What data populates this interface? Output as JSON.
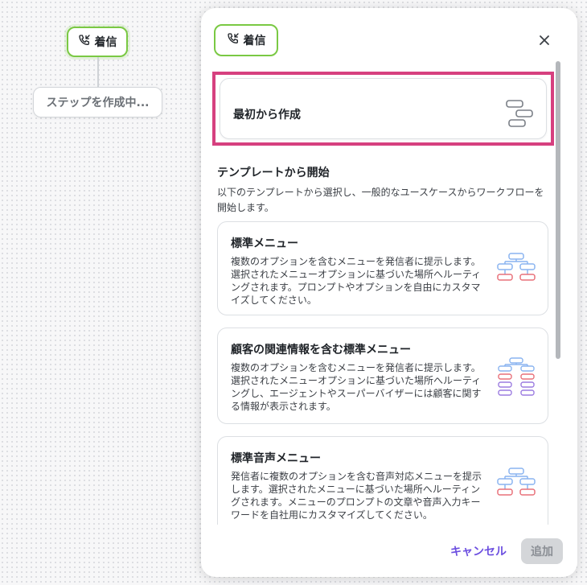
{
  "canvas": {
    "incoming_node": {
      "label": "着信",
      "icon": "phone-incoming-icon"
    },
    "creating_node": {
      "label": "ステップを作成中..."
    }
  },
  "panel": {
    "header_badge": {
      "label": "着信",
      "icon": "phone-incoming-icon"
    },
    "close_icon": "close-icon",
    "from_scratch": {
      "label": "最初から作成",
      "icon": "flow-steps-icon"
    },
    "templates_section": {
      "title": "テンプレートから開始",
      "description": "以下のテンプレートから選択し、一般的なユースケースからワークフローを開始します。"
    },
    "templates": [
      {
        "title": "標準メニュー",
        "description": "複数のオプションを含むメニューを発信者に提示します。選択されたメニューオプションに基づいた場所へルーティングされます。プロンプトやオプションを自由にカスタマイズしてください。",
        "icon": "menu-tree-icon"
      },
      {
        "title": "顧客の関連情報を含む標準メニュー",
        "description": "複数のオプションを含むメニューを発信者に提示します。選択されたメニューオプションに基づいた場所へルーティングし、エージェントやスーパーバイザーには顧客に関する情報が表示されます。",
        "icon": "menu-tree-customer-icon"
      },
      {
        "title": "標準音声メニュー",
        "description": "発信者に複数のオプションを含む音声対応メニューを提示します。選択されたメニューに基づいた場所へルーティングされます。メニューのプロンプトの文章や音声入力キーワードを自社用にカスタマイズしてください。",
        "icon": "voice-menu-tree-icon"
      }
    ],
    "footer": {
      "cancel_label": "キャンセル",
      "add_label": "追加"
    }
  },
  "colors": {
    "accent_green": "#7ac943",
    "highlight_pink": "#d6407f",
    "link_purple": "#6c4fe0",
    "tree_blue": "#8ab4f0",
    "tree_red": "#e8717a",
    "tree_purple": "#9b7be0"
  }
}
